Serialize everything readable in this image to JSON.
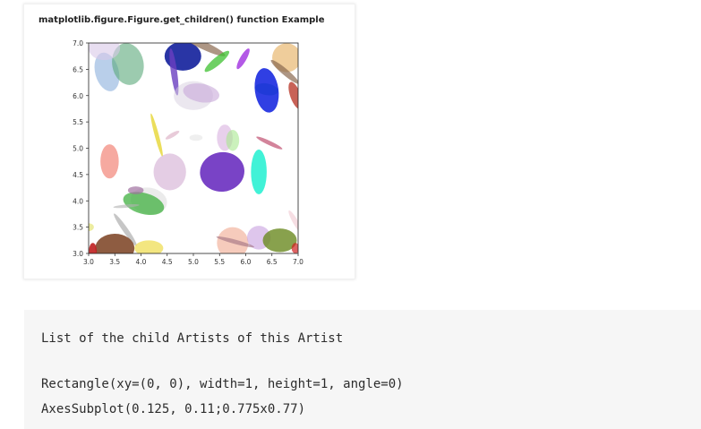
{
  "figure": {
    "title": "matplotlib.figure.Figure.get_children() function Example",
    "xlim": [
      3.0,
      7.0
    ],
    "ylim": [
      3.0,
      7.0
    ],
    "xticks": [
      "3.0",
      "3.5",
      "4.0",
      "4.5",
      "5.0",
      "5.5",
      "6.0",
      "6.5",
      "7.0"
    ],
    "yticks": [
      "3.0",
      "3.5",
      "4.0",
      "4.5",
      "5.0",
      "5.5",
      "6.0",
      "6.5",
      "7.0"
    ],
    "ellipses": [
      {
        "cx": 3.35,
        "cy": 6.45,
        "w": 0.45,
        "h": 0.75,
        "angle": 15,
        "color": "#7fa8d8",
        "alpha": 0.55
      },
      {
        "cx": 3.75,
        "cy": 6.6,
        "w": 0.6,
        "h": 0.8,
        "angle": 10,
        "color": "#5aa87a",
        "alpha": 0.6
      },
      {
        "cx": 3.3,
        "cy": 6.9,
        "w": 0.6,
        "h": 0.45,
        "angle": 0,
        "color": "#d8c8e8",
        "alpha": 0.6
      },
      {
        "cx": 4.8,
        "cy": 6.75,
        "w": 0.7,
        "h": 0.55,
        "angle": 0,
        "color": "#1d2aa0",
        "alpha": 0.95
      },
      {
        "cx": 4.63,
        "cy": 6.45,
        "w": 0.12,
        "h": 0.9,
        "angle": 8,
        "color": "#6a3fc0",
        "alpha": 0.8
      },
      {
        "cx": 5.2,
        "cy": 6.95,
        "w": 0.9,
        "h": 0.15,
        "angle": -25,
        "color": "#8a6a50",
        "alpha": 0.7
      },
      {
        "cx": 5.45,
        "cy": 6.65,
        "w": 0.6,
        "h": 0.15,
        "angle": 40,
        "color": "#3ec030",
        "alpha": 0.75
      },
      {
        "cx": 5.95,
        "cy": 6.7,
        "w": 0.45,
        "h": 0.12,
        "angle": 60,
        "color": "#a030e0",
        "alpha": 0.8
      },
      {
        "cx": 6.78,
        "cy": 6.72,
        "w": 0.55,
        "h": 0.55,
        "angle": 0,
        "color": "#e8b870",
        "alpha": 0.7
      },
      {
        "cx": 6.75,
        "cy": 6.45,
        "w": 0.7,
        "h": 0.12,
        "angle": -40,
        "color": "#8a6a50",
        "alpha": 0.7
      },
      {
        "cx": 6.4,
        "cy": 6.12,
        "w": 0.45,
        "h": 0.22,
        "angle": -10,
        "color": "#30c070",
        "alpha": 0.8
      },
      {
        "cx": 6.4,
        "cy": 6.1,
        "w": 0.45,
        "h": 0.85,
        "angle": 8,
        "color": "#1a2ae0",
        "alpha": 0.9
      },
      {
        "cx": 6.95,
        "cy": 6.0,
        "w": 0.2,
        "h": 0.55,
        "angle": 20,
        "color": "#b02010",
        "alpha": 0.7
      },
      {
        "cx": 5.0,
        "cy": 6.0,
        "w": 0.75,
        "h": 0.55,
        "angle": 0,
        "color": "#d8d0e0",
        "alpha": 0.5
      },
      {
        "cx": 5.15,
        "cy": 6.05,
        "w": 0.7,
        "h": 0.35,
        "angle": -10,
        "color": "#c8a8d8",
        "alpha": 0.6
      },
      {
        "cx": 4.3,
        "cy": 5.25,
        "w": 0.08,
        "h": 0.85,
        "angle": 15,
        "color": "#e8d840",
        "alpha": 0.85
      },
      {
        "cx": 4.6,
        "cy": 5.25,
        "w": 0.3,
        "h": 0.08,
        "angle": 30,
        "color": "#d8a8c0",
        "alpha": 0.6
      },
      {
        "cx": 3.4,
        "cy": 4.75,
        "w": 0.35,
        "h": 0.65,
        "angle": 0,
        "color": "#f07060",
        "alpha": 0.6
      },
      {
        "cx": 4.55,
        "cy": 4.55,
        "w": 0.62,
        "h": 0.7,
        "angle": 0,
        "color": "#d8b8d8",
        "alpha": 0.7
      },
      {
        "cx": 5.05,
        "cy": 5.2,
        "w": 0.25,
        "h": 0.12,
        "angle": 0,
        "color": "#d8d8d8",
        "alpha": 0.4
      },
      {
        "cx": 5.6,
        "cy": 5.2,
        "w": 0.3,
        "h": 0.5,
        "angle": 0,
        "color": "#d8b0e0",
        "alpha": 0.6
      },
      {
        "cx": 5.75,
        "cy": 5.15,
        "w": 0.25,
        "h": 0.4,
        "angle": 0,
        "color": "#a8e890",
        "alpha": 0.6
      },
      {
        "cx": 5.55,
        "cy": 4.55,
        "w": 0.85,
        "h": 0.75,
        "angle": 8,
        "color": "#6a2fc0",
        "alpha": 0.9
      },
      {
        "cx": 6.25,
        "cy": 4.55,
        "w": 0.3,
        "h": 0.85,
        "angle": 0,
        "color": "#20f0d0",
        "alpha": 0.85
      },
      {
        "cx": 6.45,
        "cy": 5.1,
        "w": 0.55,
        "h": 0.08,
        "angle": -25,
        "color": "#c05070",
        "alpha": 0.7
      },
      {
        "cx": 4.15,
        "cy": 4.0,
        "w": 0.7,
        "h": 0.5,
        "angle": -10,
        "color": "#d8d8d8",
        "alpha": 0.5
      },
      {
        "cx": 4.05,
        "cy": 3.95,
        "w": 0.8,
        "h": 0.4,
        "angle": -15,
        "color": "#40b040",
        "alpha": 0.75
      },
      {
        "cx": 3.9,
        "cy": 4.2,
        "w": 0.3,
        "h": 0.15,
        "angle": 0,
        "color": "#a070a0",
        "alpha": 0.7
      },
      {
        "cx": 3.72,
        "cy": 3.9,
        "w": 0.5,
        "h": 0.06,
        "angle": 5,
        "color": "#b0b0b0",
        "alpha": 0.6
      },
      {
        "cx": 3.7,
        "cy": 3.45,
        "w": 0.1,
        "h": 0.75,
        "angle": 35,
        "color": "#a0a0a0",
        "alpha": 0.6
      },
      {
        "cx": 3.5,
        "cy": 3.1,
        "w": 0.75,
        "h": 0.55,
        "angle": 0,
        "color": "#7a4020",
        "alpha": 0.85
      },
      {
        "cx": 3.08,
        "cy": 3.05,
        "w": 0.15,
        "h": 0.3,
        "angle": 0,
        "color": "#c02020",
        "alpha": 0.9
      },
      {
        "cx": 4.15,
        "cy": 3.1,
        "w": 0.55,
        "h": 0.3,
        "angle": 0,
        "color": "#f0e060",
        "alpha": 0.8
      },
      {
        "cx": 3.0,
        "cy": 3.5,
        "w": 0.2,
        "h": 0.15,
        "angle": 0,
        "color": "#e0e060",
        "alpha": 0.6
      },
      {
        "cx": 5.75,
        "cy": 3.2,
        "w": 0.6,
        "h": 0.6,
        "angle": 0,
        "color": "#f0a890",
        "alpha": 0.6
      },
      {
        "cx": 6.25,
        "cy": 3.3,
        "w": 0.45,
        "h": 0.45,
        "angle": 0,
        "color": "#c8a0e0",
        "alpha": 0.6
      },
      {
        "cx": 6.65,
        "cy": 3.25,
        "w": 0.65,
        "h": 0.45,
        "angle": 0,
        "color": "#6a8a20",
        "alpha": 0.8
      },
      {
        "cx": 5.8,
        "cy": 3.22,
        "w": 0.75,
        "h": 0.08,
        "angle": -15,
        "color": "#a07080",
        "alpha": 0.6
      },
      {
        "cx": 6.95,
        "cy": 3.6,
        "w": 0.1,
        "h": 0.5,
        "angle": 30,
        "color": "#f0c8d0",
        "alpha": 0.6
      },
      {
        "cx": 6.95,
        "cy": 3.1,
        "w": 0.15,
        "h": 0.2,
        "angle": 0,
        "color": "#d02020",
        "alpha": 0.7
      }
    ]
  },
  "output": {
    "line1": "List of the child Artists of this Artist",
    "line2": "Rectangle(xy=(0, 0), width=1, height=1, angle=0)",
    "line3": "AxesSubplot(0.125, 0.11;0.775x0.77)"
  }
}
